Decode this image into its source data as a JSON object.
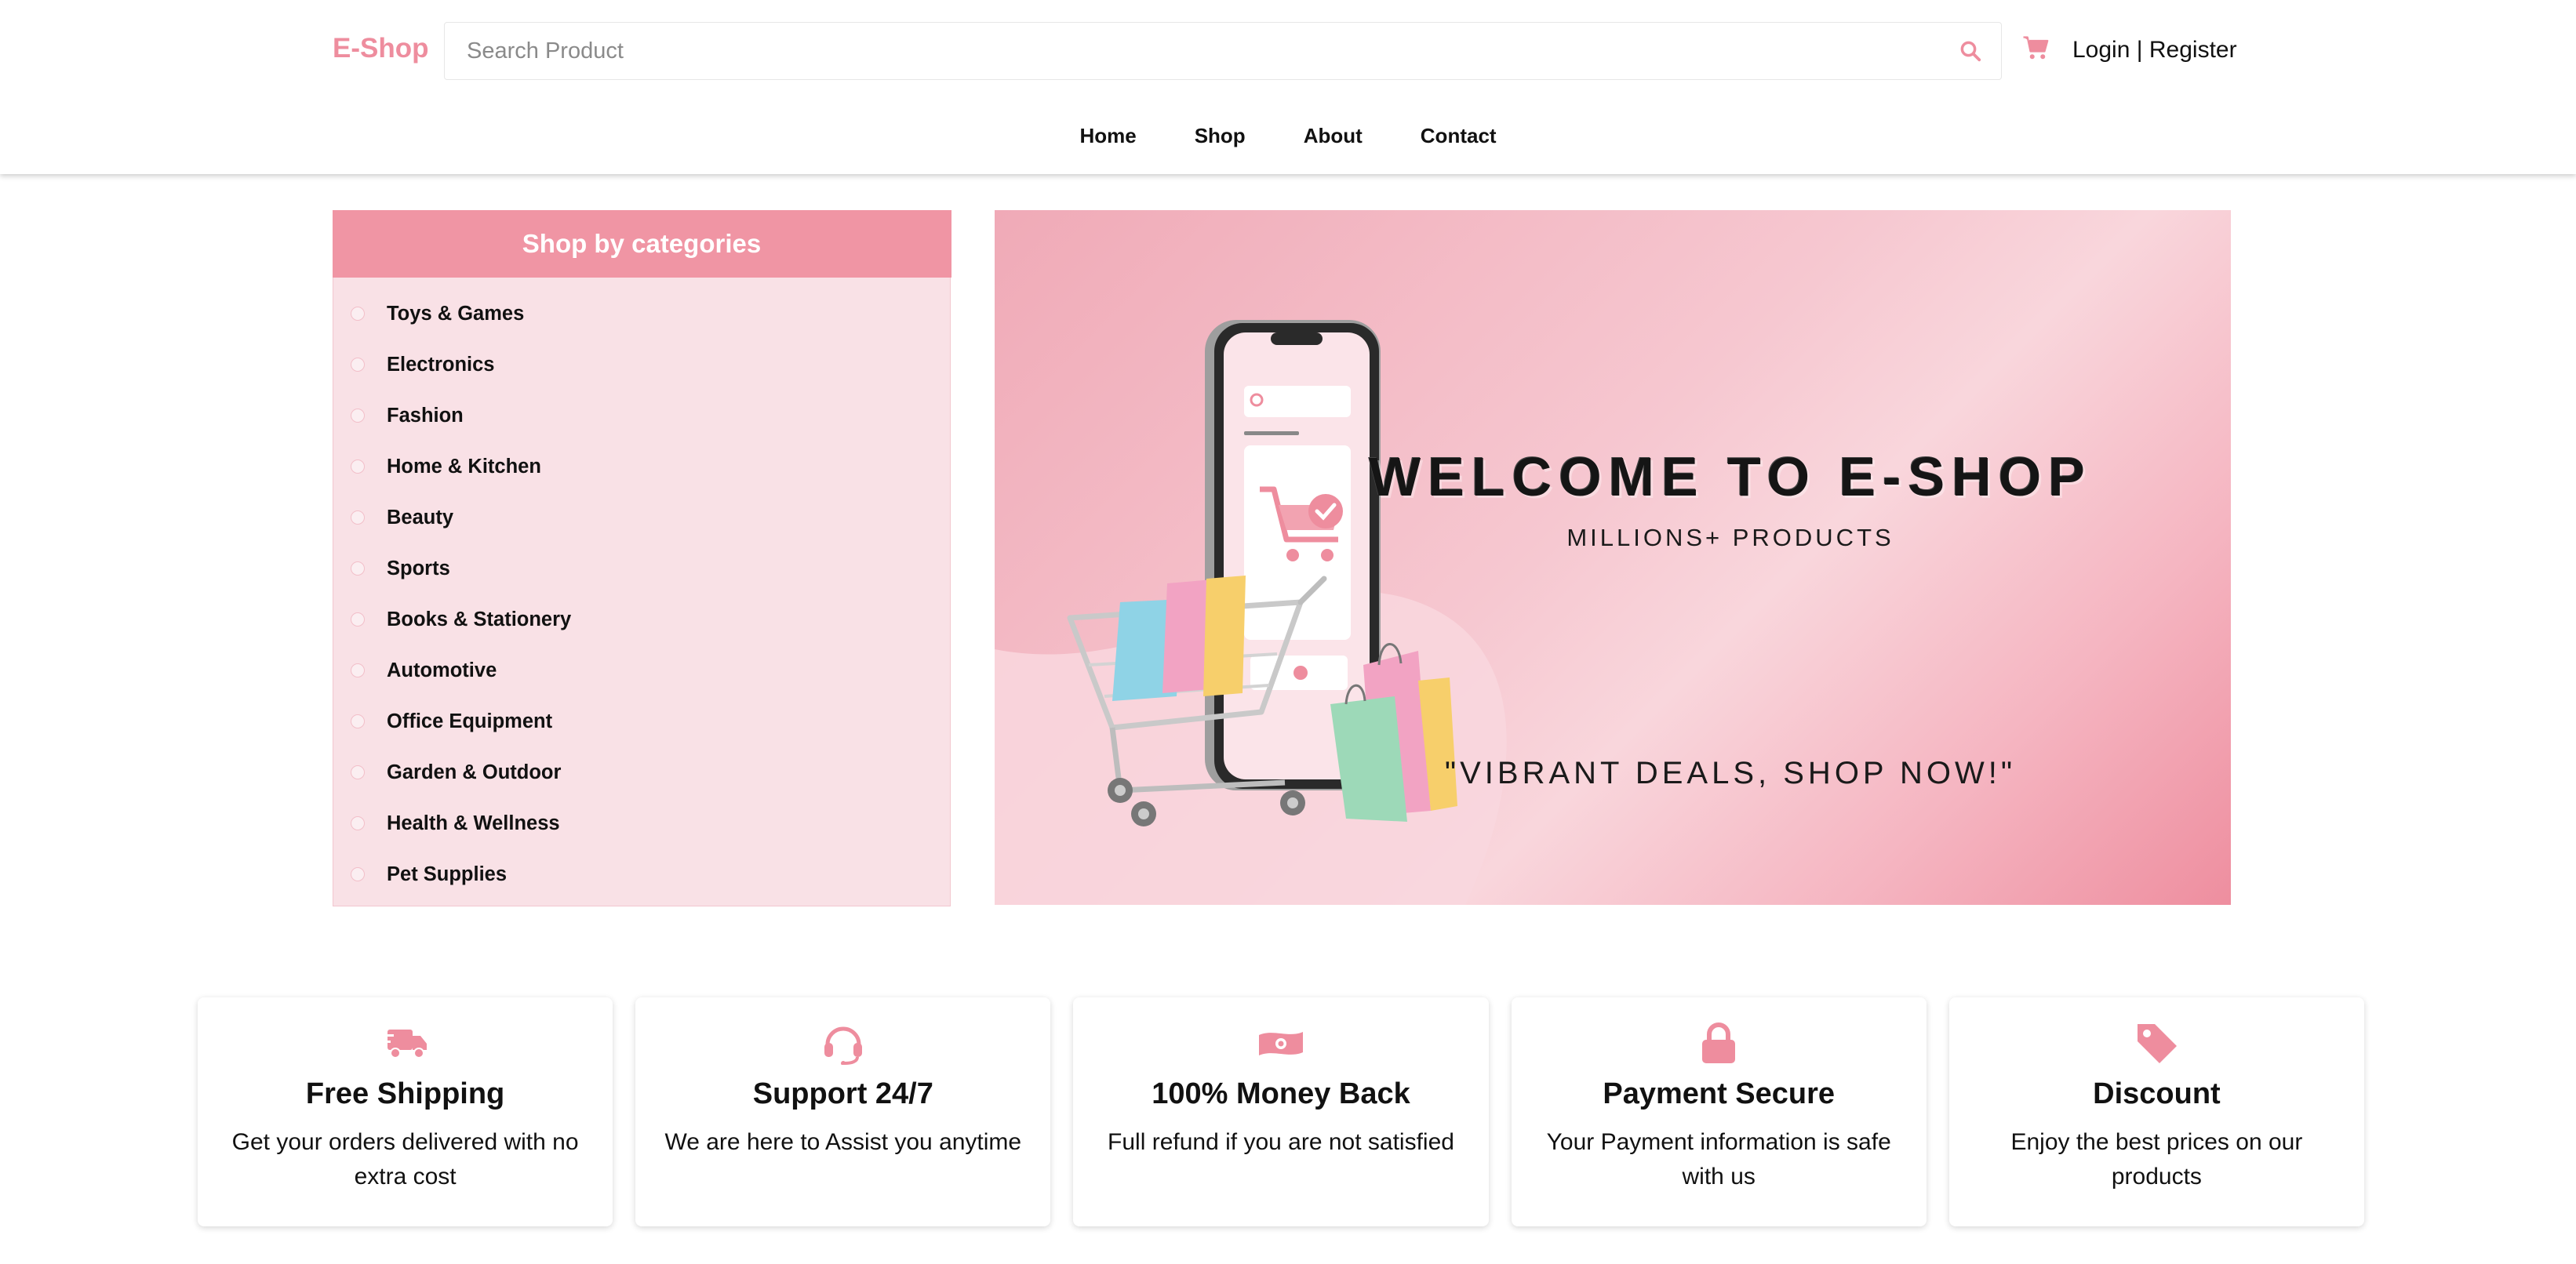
{
  "colors": {
    "accent": "#f095a4",
    "logo": "#ee8d9e",
    "panel": "#f9e1e6"
  },
  "header": {
    "logo": "E-Shop",
    "search": {
      "placeholder": "Search Product",
      "icon": "search-icon"
    },
    "cart_icon": "cart-icon",
    "auth": {
      "login": "Login",
      "separator": " | ",
      "register": "Register"
    }
  },
  "nav": {
    "items": [
      "Home",
      "Shop",
      "About",
      "Contact"
    ]
  },
  "categories": {
    "title": "Shop by categories",
    "items": [
      "Toys & Games",
      "Electronics",
      "Fashion",
      "Home & Kitchen",
      "Beauty",
      "Sports",
      "Books & Stationery",
      "Automotive",
      "Office Equipment",
      "Garden & Outdoor",
      "Health & Wellness",
      "Pet Supplies"
    ]
  },
  "banner": {
    "title": "WELCOME TO E-SHOP",
    "subtitle": "MILLIONS+ PRODUCTS",
    "tagline": "\"VIBRANT DEALS, SHOP NOW!\""
  },
  "features": [
    {
      "icon": "truck-icon",
      "title": "Free Shipping",
      "desc": "Get your orders delivered with no extra cost"
    },
    {
      "icon": "headset-icon",
      "title": "Support 24/7",
      "desc": "We are here to Assist you anytime"
    },
    {
      "icon": "money-icon",
      "title": "100% Money Back",
      "desc": "Full refund if you are not satisfied"
    },
    {
      "icon": "lock-icon",
      "title": "Payment Secure",
      "desc": "Your Payment information is safe with us"
    },
    {
      "icon": "tag-icon",
      "title": "Discount",
      "desc": "Enjoy the best prices on our products"
    }
  ]
}
